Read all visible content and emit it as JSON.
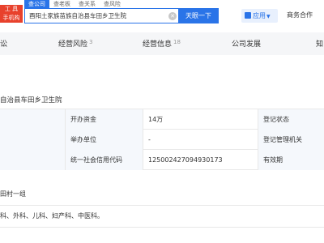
{
  "header": {
    "logo_lines": [
      "工 具",
      "手机构"
    ],
    "search_tabs": [
      "查公司",
      "查老板",
      "查关系",
      "查风险"
    ],
    "search_value": "酉阳土家族苗族自治县车田乡卫生院",
    "search_button": "天眼一下",
    "apps_label": "应用",
    "coop_label": "商务合作"
  },
  "nav": {
    "items": [
      {
        "label": "讼",
        "count": ""
      },
      {
        "label": "经营风险",
        "count": "3"
      },
      {
        "label": "经营信息",
        "count": "18"
      },
      {
        "label": "公司发展",
        "count": ""
      },
      {
        "label": "知",
        "count": ""
      }
    ]
  },
  "company_name_partial": "自治县车田乡卫生院",
  "table": {
    "rows": [
      {
        "label1": "开办资金",
        "value1": "14万",
        "label2": "登记状态"
      },
      {
        "label1": "举办单位",
        "value1": "-",
        "label2": "登记管理机关"
      },
      {
        "label1": "统一社会信用代码",
        "value1": "12500242709493017З",
        "label2": "有效期"
      }
    ]
  },
  "address_partial": "田村一组",
  "scope_partial": "科、外科、儿科、妇产科、中医科。"
}
